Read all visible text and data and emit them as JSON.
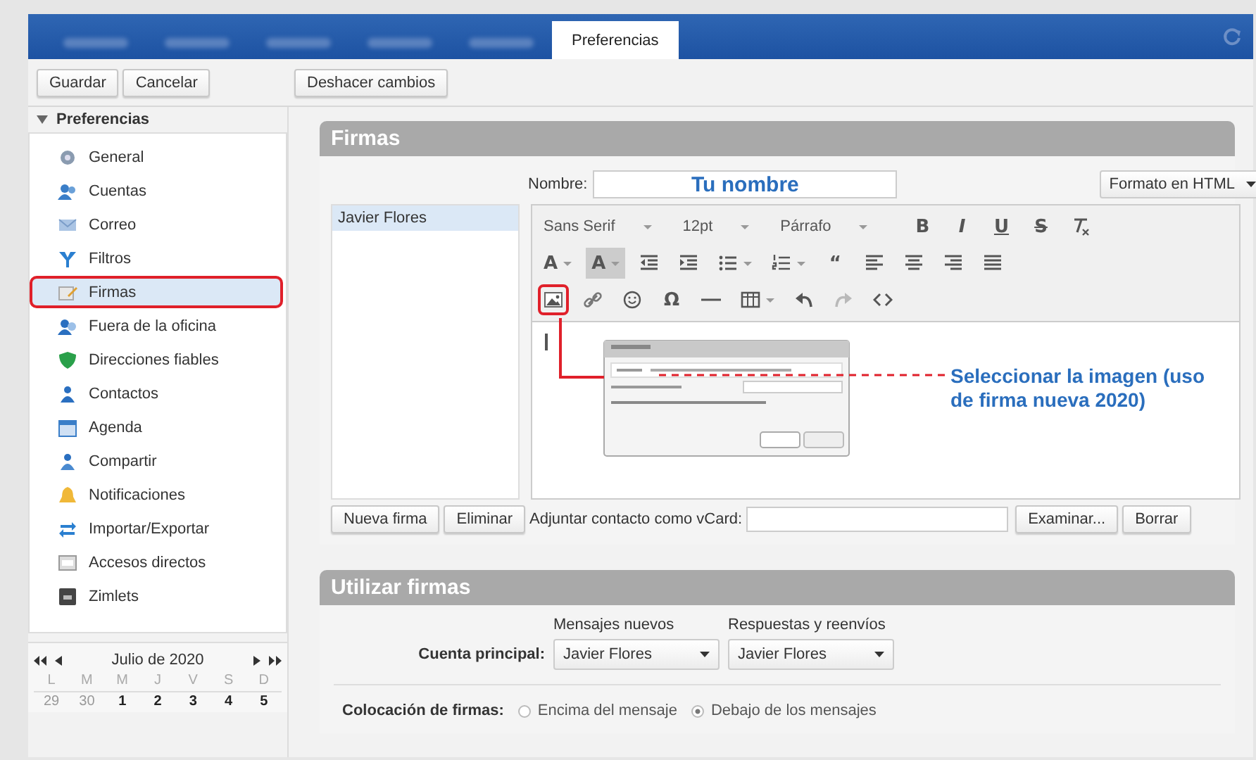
{
  "tabs": [
    {
      "selected": false
    },
    {
      "selected": false
    },
    {
      "selected": false
    },
    {
      "selected": false
    },
    {
      "selected": false
    },
    {
      "label": "Preferencias",
      "selected": true
    }
  ],
  "toolbar": {
    "left_buttons": [
      "Guardar",
      "Cancelar"
    ],
    "right_buttons": [
      "Deshacer cambios"
    ]
  },
  "sidebar": {
    "header": "Preferencias",
    "expanded": true,
    "items": [
      {
        "label": "General",
        "selected": false,
        "highlighted": false
      },
      {
        "label": "Cuentas",
        "selected": false,
        "highlighted": false
      },
      {
        "label": "Correo",
        "selected": false,
        "highlighted": false
      },
      {
        "label": "Filtros",
        "selected": false,
        "highlighted": false
      },
      {
        "label": "Firmas",
        "selected": true,
        "highlighted": true
      },
      {
        "label": "Fuera de la oficina",
        "selected": false,
        "highlighted": false
      },
      {
        "label": "Direcciones fiables",
        "selected": false,
        "highlighted": false
      },
      {
        "label": "Contactos",
        "selected": false,
        "highlighted": false
      },
      {
        "label": "Agenda",
        "selected": false,
        "highlighted": false
      },
      {
        "label": "Compartir",
        "selected": false,
        "highlighted": false
      },
      {
        "label": "Notificaciones",
        "selected": false,
        "highlighted": false
      },
      {
        "label": "Importar/Exportar",
        "selected": false,
        "highlighted": false
      },
      {
        "label": "Accesos directos",
        "selected": false,
        "highlighted": false
      },
      {
        "label": "Zimlets",
        "selected": false,
        "highlighted": false
      }
    ]
  },
  "calendar": {
    "month": "Julio de 2020",
    "weekdays": [
      "L",
      "M",
      "M",
      "J",
      "V",
      "S",
      "D"
    ],
    "days": [
      {
        "label": "29",
        "other_month": true
      },
      {
        "label": "30",
        "other_month": true
      },
      {
        "label": "1",
        "other_month": false
      },
      {
        "label": "2",
        "other_month": false
      },
      {
        "label": "3",
        "other_month": false
      },
      {
        "label": "4",
        "other_month": false
      },
      {
        "label": "5",
        "other_month": false
      }
    ]
  },
  "signatures": {
    "title": "Firmas",
    "name_label": "Nombre:",
    "name_value": "Tu nombre",
    "format": "Formato en HTML",
    "list": [
      {
        "label": "Javier Flores",
        "selected": true
      }
    ],
    "editor": {
      "selects": [
        "Sans Serif",
        "12pt",
        "Párrafo"
      ],
      "rows": [
        [
          {
            "kind": "char",
            "text": "B",
            "disabled": false,
            "dropdown": false,
            "highlighted": false
          },
          {
            "kind": "char",
            "text": "I",
            "disabled": false,
            "dropdown": false,
            "highlighted": false
          },
          {
            "kind": "char",
            "text": "U",
            "disabled": false,
            "dropdown": false,
            "highlighted": false
          },
          {
            "kind": "char",
            "text": "S",
            "disabled": false,
            "dropdown": false,
            "highlighted": false
          },
          {
            "kind": "icon",
            "disabled": false,
            "dropdown": false,
            "highlighted": false
          }
        ],
        [
          {
            "kind": "char",
            "text": "A",
            "disabled": false,
            "dropdown": true,
            "highlighted": false
          },
          {
            "kind": "char",
            "text": "A",
            "disabled": false,
            "dropdown": true,
            "highlighted": false
          },
          {
            "kind": "icon",
            "disabled": false,
            "dropdown": false,
            "highlighted": false
          },
          {
            "kind": "icon",
            "disabled": false,
            "dropdown": false,
            "highlighted": false
          },
          {
            "kind": "icon",
            "disabled": false,
            "dropdown": true,
            "highlighted": false
          },
          {
            "kind": "icon",
            "disabled": false,
            "dropdown": true,
            "highlighted": false
          },
          {
            "kind": "char",
            "text": "“",
            "disabled": false,
            "dropdown": false,
            "highlighted": false
          },
          {
            "kind": "icon",
            "disabled": false,
            "dropdown": false,
            "highlighted": false
          },
          {
            "kind": "icon",
            "disabled": false,
            "dropdown": false,
            "highlighted": false
          },
          {
            "kind": "icon",
            "disabled": false,
            "dropdown": false,
            "highlighted": false
          },
          {
            "kind": "icon",
            "disabled": false,
            "dropdown": false,
            "highlighted": false
          }
        ],
        [
          {
            "kind": "icon",
            "disabled": false,
            "dropdown": false,
            "highlighted": true
          },
          {
            "kind": "icon",
            "disabled": false,
            "dropdown": false,
            "highlighted": false
          },
          {
            "kind": "icon",
            "disabled": false,
            "dropdown": false,
            "highlighted": false
          },
          {
            "kind": "char",
            "text": "Ω",
            "disabled": false,
            "dropdown": false,
            "highlighted": false
          },
          {
            "kind": "icon",
            "disabled": false,
            "dropdown": false,
            "highlighted": false
          },
          {
            "kind": "icon",
            "disabled": false,
            "dropdown": true,
            "highlighted": false
          },
          {
            "kind": "icon",
            "disabled": false,
            "dropdown": false,
            "highlighted": false
          },
          {
            "kind": "icon",
            "disabled": true,
            "dropdown": false,
            "highlighted": false
          },
          {
            "kind": "icon",
            "disabled": false,
            "dropdown": false,
            "highlighted": false
          }
        ]
      ]
    },
    "buttons": [
      "Nueva firma",
      "Eliminar"
    ],
    "vcard_label": "Adjuntar contacto como vCard:",
    "vcard_buttons": [
      "Examinar...",
      "Borrar"
    ]
  },
  "annotation": {
    "text": "Seleccionar la imagen (uso de firma nueva 2020)"
  },
  "use": {
    "title": "Utilizar firmas",
    "columns": [
      "Mensajes nuevos",
      "Respuestas y reenvíos"
    ],
    "account_label": "Cuenta principal:",
    "selects": [
      "Javier Flores",
      "Javier Flores"
    ],
    "placement_label": "Colocación de firmas:",
    "options": [
      {
        "label": "Encima del mensaje",
        "selected": false
      },
      {
        "label": "Debajo de los mensajes",
        "selected": true
      }
    ]
  }
}
